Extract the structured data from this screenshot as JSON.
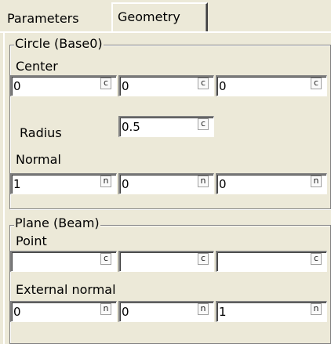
{
  "tabs": [
    {
      "label": "Parameters",
      "active": false
    },
    {
      "label": "Geometry",
      "active": true
    }
  ],
  "circle_group": {
    "title": "Circle (Base0)",
    "center_label": "Center",
    "center": [
      {
        "value": "0",
        "unit": "c"
      },
      {
        "value": "0",
        "unit": "c"
      },
      {
        "value": "0",
        "unit": "c"
      }
    ],
    "radius_label": "Radius",
    "radius": {
      "value": "0.5",
      "unit": "c"
    },
    "normal_label": "Normal",
    "normal": [
      {
        "value": "1",
        "unit": "n"
      },
      {
        "value": "0",
        "unit": "n"
      },
      {
        "value": "0",
        "unit": "n"
      }
    ]
  },
  "plane_group": {
    "title": "Plane (Beam)",
    "point_label": "Point",
    "point": [
      {
        "value": "",
        "unit": "c"
      },
      {
        "value": "",
        "unit": "c"
      },
      {
        "value": "",
        "unit": "c"
      }
    ],
    "external_normal_label": "External normal",
    "external_normal": [
      {
        "value": "0",
        "unit": "n"
      },
      {
        "value": "0",
        "unit": "n"
      },
      {
        "value": "1",
        "unit": "n"
      }
    ]
  }
}
